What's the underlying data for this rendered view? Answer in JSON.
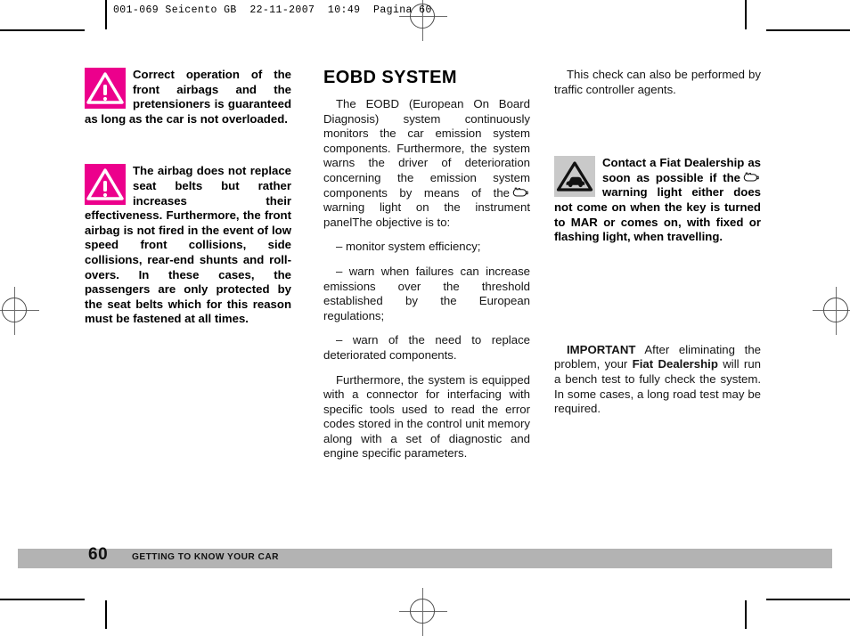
{
  "page_header": "001-069 Seicento GB  22-11-2007  10:49  Pagina 60",
  "left_column": {
    "warning_1": {
      "icon": "magenta-triangle-exclamation-icon",
      "text": "Correct operation of the front airbags and the pretensioners is guaranteed as long as the car is not overloaded."
    },
    "warning_2": {
      "icon": "magenta-triangle-exclamation-icon",
      "text": "The airbag does not replace seat belts but rather increases their effectiveness. Furthermore, the front airbag is not fired in the event of low speed front collisions, side collisions, rear-end shunts and roll-overs. In these cases, the passengers are only protected by the seat belts which for this reason must be fastened at all times."
    }
  },
  "middle_column": {
    "heading": "EOBD SYSTEM",
    "paragraph_1_before_glyph": "The EOBD (European On Board Diagnosis) system continuously monitors the car emission system components. Furthermore, the system warns the driver of deterioration concerning the emission system components by means of the",
    "engine_glyph": "engine-warning-light-icon",
    "paragraph_1_after_glyph": "warning light on the instrument panelThe objective is to:",
    "list_items": [
      "– monitor system efficiency;",
      "– warn when failures can increase emissions over the threshold established by the European regulations;",
      "– warn of the need to replace deteriorated components."
    ],
    "paragraph_2": "Furthermore, the system is equipped with a connector for interfacing with specific tools used to read the error codes stored in the control unit memory along with a set of diagnostic and engine specific parameters."
  },
  "right_column": {
    "paragraph_1": "This check can also be performed by traffic controller agents.",
    "warning": {
      "icon": "grey-triangle-car-icon",
      "text_part_1": "Contact a Fiat Dealership as soon as possible if the",
      "engine_glyph": "engine-warning-light-icon",
      "text_part_2": "warning light either does not come on when the key is turned to",
      "emphasis": "MAR",
      "text_part_3": "or comes on, with fixed or flashing light, when travelling."
    },
    "important_note": {
      "label": "IMPORTANT",
      "text_part_1": "After eliminating the problem, your",
      "bold_term": "Fiat Dealership",
      "text_part_2": "will run a bench test to fully check the system. In some cases, a long road test may be required."
    }
  },
  "footer": {
    "page_number": "60",
    "section_label": "GETTING TO KNOW YOUR CAR"
  },
  "colors": {
    "warning_magenta": "#ec008c",
    "warning_grey": "#c9c9c9",
    "footer_bar": "#b3b3b3",
    "text": "#141414"
  }
}
